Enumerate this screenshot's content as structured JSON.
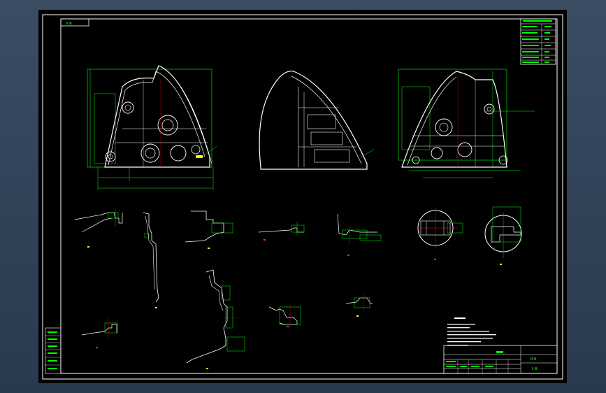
{
  "drawing": {
    "tag_label": "Ⅱ-Ⅲ",
    "drawing_no": "Ⅱ-Ⅲ",
    "material_label": "B-B"
  },
  "colors": {
    "frame": "#ffffff",
    "dimension": "#00ff00",
    "centerline": "#ff00ff",
    "highlight": "#ffff00",
    "canvas": "#000000"
  }
}
